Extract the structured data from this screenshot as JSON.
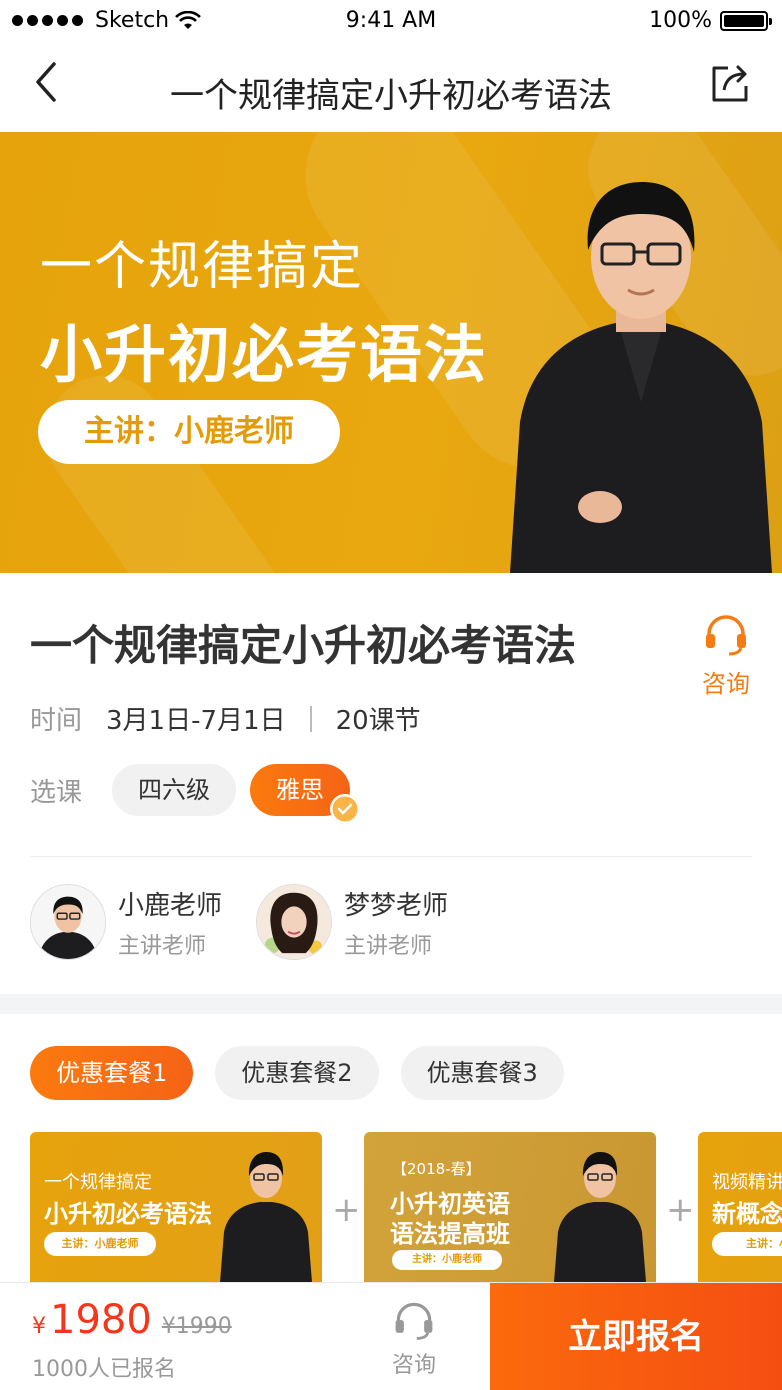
{
  "status_bar": {
    "carrier": "Sketch",
    "time": "9:41 AM",
    "battery": "100%"
  },
  "nav": {
    "title": "一个规律搞定小升初必考语法",
    "back_icon": "chevron-left-icon",
    "share_icon": "share-icon"
  },
  "banner": {
    "line1": "一个规律搞定",
    "line2": "小升初必考语法",
    "pill": "主讲：小鹿老师"
  },
  "course": {
    "title": "一个规律搞定小升初必考语法",
    "consult_label": "咨询",
    "time_label": "时间",
    "time_value": "3月1日-7月1日",
    "lessons": "20课节",
    "select_label": "选课",
    "options": [
      {
        "label": "四六级",
        "selected": false
      },
      {
        "label": "雅思",
        "selected": true
      }
    ]
  },
  "teachers": [
    {
      "name": "小鹿老师",
      "role": "主讲老师"
    },
    {
      "name": "梦梦老师",
      "role": "主讲老师"
    }
  ],
  "packages": {
    "tabs": [
      "优惠套餐1",
      "优惠套餐2",
      "优惠套餐3"
    ],
    "active_tab": 0,
    "cards": [
      {
        "line1": "一个规律搞定",
        "line2": "小升初必考语法",
        "pill": "主讲：小鹿老师"
      },
      {
        "tag": "【2018-春】",
        "line1": "小升初英语",
        "line2": "语法提高班",
        "pill": "主讲：小鹿老师"
      },
      {
        "line1": "视频精讲",
        "line2": "新概念",
        "pill": "主讲：小"
      }
    ]
  },
  "bottom": {
    "currency": "¥",
    "price": "1980",
    "original_price": "¥1990",
    "enrolled": "1000人已报名",
    "consult_label": "咨询",
    "enroll_button": "立即报名"
  },
  "colors": {
    "accent": "#f57c13",
    "price": "#f5361b",
    "banner": "#e6a30c"
  }
}
